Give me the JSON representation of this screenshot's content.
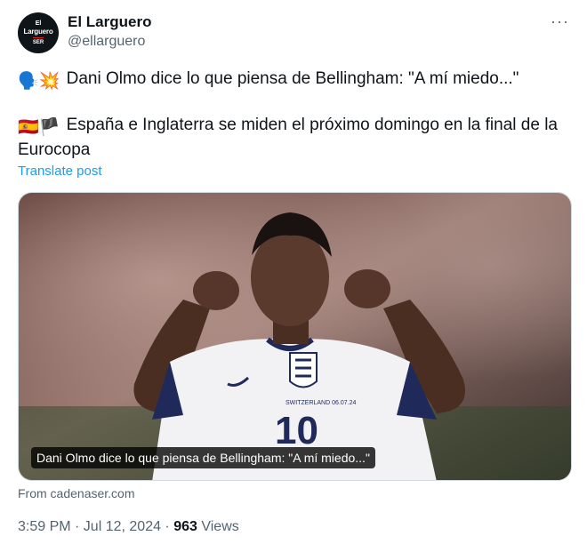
{
  "account": {
    "avatar_top": "El",
    "avatar_mid": "Larguero",
    "avatar_bottom": "SER",
    "name": "El Larguero",
    "handle": "@ellarguero"
  },
  "post": {
    "line1_emoji": "🗣️💥",
    "line1": "Dani Olmo dice lo que piensa de Bellingham: \"A mí miedo...\"",
    "line2_emoji": "🇪🇸🏴",
    "line2": "España e Inglaterra se miden el próximo domingo en la final de la Eurocopa",
    "translate": "Translate post"
  },
  "media": {
    "caption": "Dani Olmo dice lo que piensa de Bellingham: \"A mí miedo...\"",
    "shirt_number": "10",
    "shirt_text": "SWITZERLAND 06.07.24"
  },
  "card": {
    "source": "From cadenaser.com"
  },
  "meta": {
    "time": "3:59 PM · Jul 12, 2024 · ",
    "views_count": "963",
    "views_label": "Views"
  },
  "colors": {
    "link": "#1d9bf0",
    "secondary": "#536471",
    "text": "#0f1419"
  },
  "icons": {
    "more": "more-horizontal-icon"
  }
}
